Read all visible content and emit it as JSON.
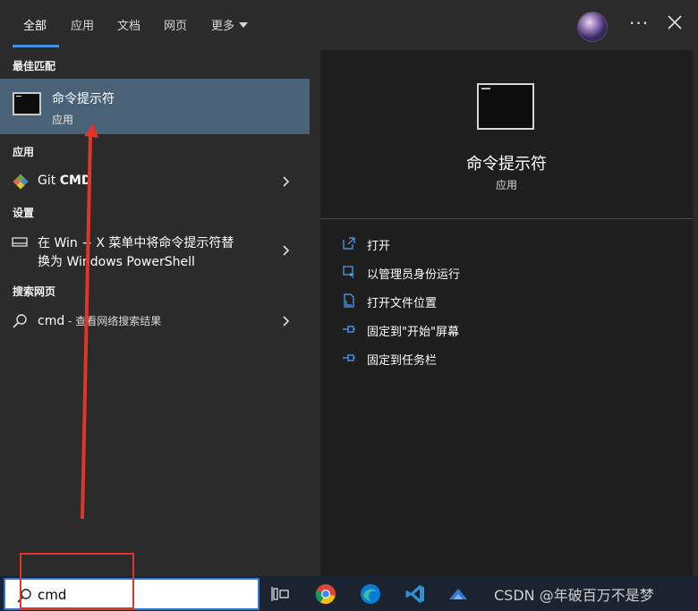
{
  "tabs": [
    {
      "label": "全部",
      "active": true
    },
    {
      "label": "应用"
    },
    {
      "label": "文档"
    },
    {
      "label": "网页"
    },
    {
      "label": "更多"
    }
  ],
  "header": {
    "more_label": "···"
  },
  "best_match": {
    "heading": "最佳匹配",
    "title": "命令提示符",
    "subtitle": "应用"
  },
  "apps": {
    "heading": "应用",
    "item_prefix": "Git ",
    "item_bold": "CMD"
  },
  "settings": {
    "heading": "设置",
    "line1": "在 Win + X 菜单中将命令提示符替",
    "line2": "换为 Windows PowerShell"
  },
  "web": {
    "heading": "搜索网页",
    "query": "cmd",
    "suffix": " - 查看网络搜索结果"
  },
  "details": {
    "title": "命令提示符",
    "subtitle": "应用",
    "actions": [
      {
        "label": "打开",
        "icon": "open-icon"
      },
      {
        "label": "以管理员身份运行",
        "icon": "shield-run-icon"
      },
      {
        "label": "打开文件位置",
        "icon": "file-location-icon"
      },
      {
        "label": "固定到\"开始\"屏幕",
        "icon": "pin-icon"
      },
      {
        "label": "固定到任务栏",
        "icon": "pin-icon"
      }
    ]
  },
  "taskbar": {
    "search_value": "cmd",
    "watermark": "CSDN @年破百万不是梦"
  },
  "colors": {
    "accent": "#3e90e0",
    "selected_row": "#4a6278",
    "annotation": "#e0352a"
  }
}
